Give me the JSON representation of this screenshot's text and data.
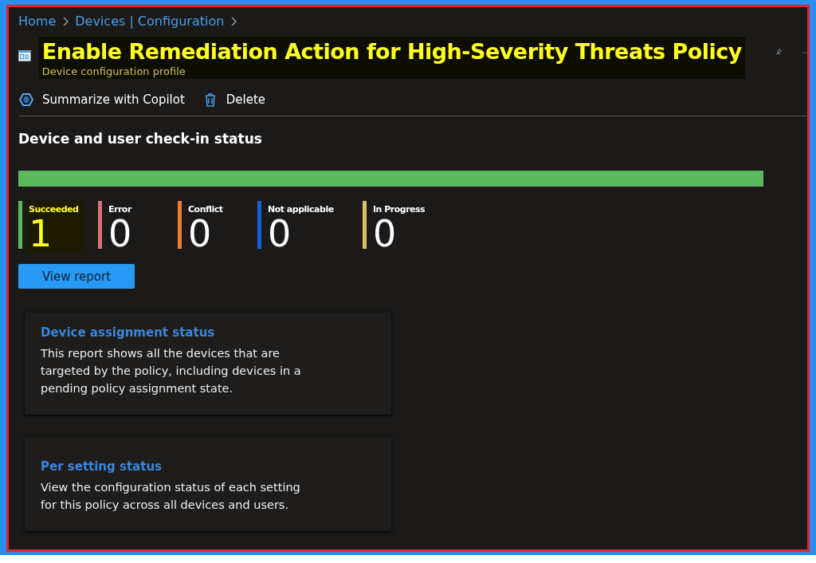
{
  "breadcrumb": [
    "Home",
    "Devices | Configuration"
  ],
  "header": {
    "title": "Enable Remediation Action for High-Severity Threats Policy",
    "subtitle": "Device configuration profile",
    "highlighted": true
  },
  "toolbar": [
    {
      "label": "Summarize with Copilot",
      "kind": "copilot"
    },
    {
      "label": "Delete",
      "kind": "delete"
    }
  ],
  "checkin": {
    "title": "Device and user check-in status",
    "level": 1,
    "statuses": [
      {
        "label": "Succeeded",
        "count": "1",
        "color": "#5cb85c",
        "highlighted": true
      },
      {
        "label": "Error",
        "count": "0",
        "color": "#d9717a",
        "highlighted": false
      },
      {
        "label": "Conflict",
        "count": "0",
        "color": "#f07f2e",
        "highlighted": false
      },
      {
        "label": "Not applicable",
        "count": "0",
        "color": "#1563d6",
        "highlighted": false
      },
      {
        "label": "In Progress",
        "count": "0",
        "color": "#d9c064",
        "highlighted": false
      }
    ],
    "button": "View report"
  },
  "reports": [
    {
      "title": "Device assignment status",
      "description": "This report shows all the devices that are targeted by the policy, including devices in a pending policy assignment state."
    },
    {
      "title": "Per setting status",
      "description": "View the configuration status of each setting for this policy across all devices and users."
    }
  ]
}
